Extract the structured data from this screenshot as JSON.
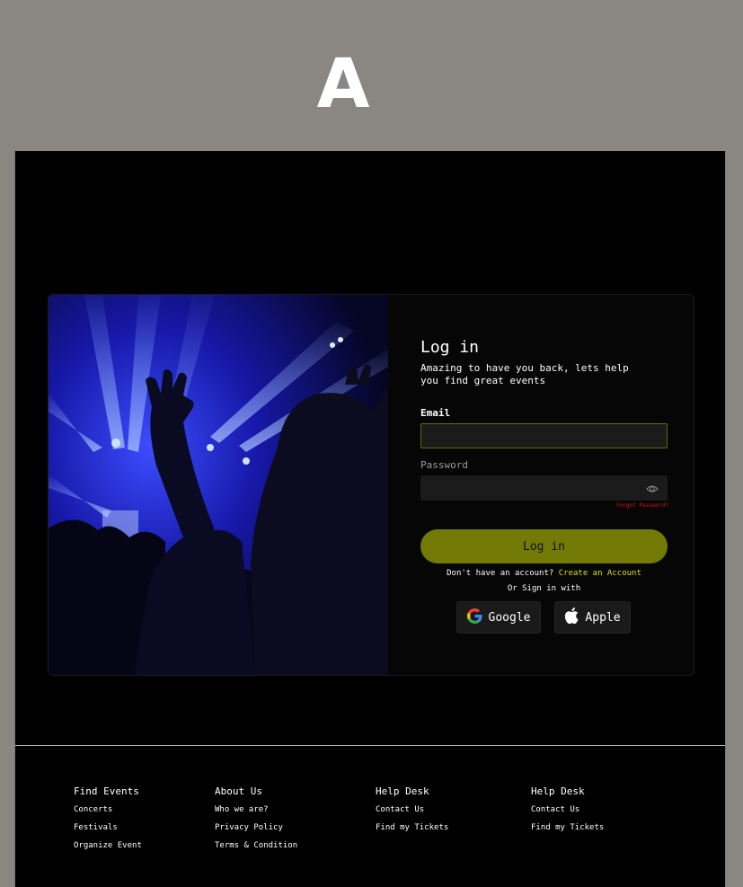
{
  "header": {
    "letter": "A"
  },
  "login": {
    "title": "Log in",
    "subtitle": "Amazing to have you back, lets help you find great events",
    "email_label": "Email",
    "email_value": "",
    "password_label": "Password",
    "password_value": "",
    "forgot_label": "Forgot Password?",
    "submit_label": "Log in",
    "signup_prompt": "Don't have an account?",
    "signup_link": "Create an Account",
    "or_text": "Or Sign in with",
    "google_label": "Google",
    "apple_label": "Apple"
  },
  "footer": {
    "columns": [
      {
        "title": "Find Events",
        "links": [
          "Concerts",
          "Festivals",
          "Organize Event"
        ]
      },
      {
        "title": "About Us",
        "links": [
          "Who we are?",
          "Privacy Policy",
          "Terms & Condition"
        ]
      },
      {
        "title": "Help Desk",
        "links": [
          "Contact Us",
          "Find my Tickets"
        ]
      },
      {
        "title": "Help Desk",
        "links": [
          "Contact Us",
          "Find my Tickets"
        ]
      }
    ]
  },
  "colors": {
    "accent": "#737b06",
    "link": "#d7de1c",
    "warning": "#dd1111",
    "page_bg": "#8a8782",
    "frame_bg": "#000000"
  },
  "icons": [
    "eye-icon",
    "google-icon",
    "apple-icon"
  ]
}
